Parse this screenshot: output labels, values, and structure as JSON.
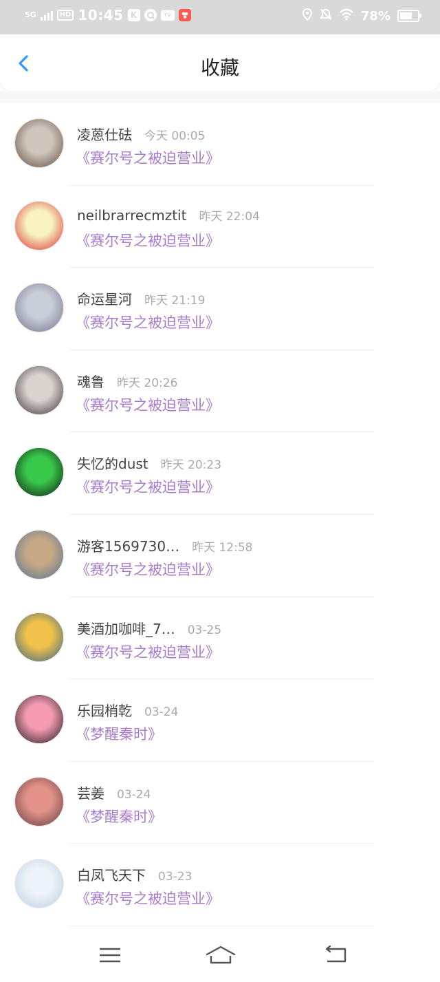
{
  "status_bar": {
    "network": "5G",
    "hd": "HD",
    "time": "10:45",
    "k_icon": "K",
    "tv_icon": "TV",
    "battery": "78%",
    "battery_level": 0.78
  },
  "header": {
    "title": "收藏",
    "back_icon": "chevron-left-icon"
  },
  "items": [
    {
      "name": "凌蒽仕砝",
      "time": "今天 00:05",
      "title": "《赛尔号之被迫营业》",
      "avatar_colors": [
        "#cfc7bd",
        "#5a4338"
      ]
    },
    {
      "name": "neilbrarrecmztit",
      "time": "昨天 22:04",
      "title": "《赛尔号之被迫营业》",
      "avatar_colors": [
        "#f7f2bf",
        "#d8232a"
      ]
    },
    {
      "name": "命运星河",
      "time": "昨天 21:19",
      "title": "《赛尔号之被迫营业》",
      "avatar_colors": [
        "#c9cdd8",
        "#6d6f86"
      ]
    },
    {
      "name": "魂鲁",
      "time": "昨天 20:26",
      "title": "《赛尔号之被迫营业》",
      "avatar_colors": [
        "#d8d3cf",
        "#2f2a28"
      ]
    },
    {
      "name": "失忆的dust",
      "time": "昨天 20:23",
      "title": "《赛尔号之被迫营业》",
      "avatar_colors": [
        "#39c94a",
        "#0c0d12"
      ]
    },
    {
      "name": "游客1569730…",
      "time": "昨天 12:58",
      "title": "《赛尔号之被迫营业》",
      "avatar_colors": [
        "#c6a884",
        "#4d6f96"
      ]
    },
    {
      "name": "美酒加咖啡_7…",
      "time": "03-25",
      "title": "《赛尔号之被迫营业》",
      "avatar_colors": [
        "#f0c24a",
        "#2a5d8a"
      ]
    },
    {
      "name": "乐园梢乾",
      "time": "03-24",
      "title": "《梦醒秦时》",
      "avatar_colors": [
        "#f49ab1",
        "#101210"
      ]
    },
    {
      "name": "芸姜",
      "time": "03-24",
      "title": "《梦醒秦时》",
      "avatar_colors": [
        "#e3928a",
        "#5a3a3a"
      ]
    },
    {
      "name": "白凤飞天下",
      "time": "03-23",
      "title": "《赛尔号之被迫营业》",
      "avatar_colors": [
        "#eef3f9",
        "#b8cbe0"
      ]
    }
  ],
  "nav_bar": {
    "menu_icon": "menu-icon",
    "home_icon": "home-icon",
    "back_icon": "back-icon"
  },
  "colors": {
    "accent": "#3399ff",
    "title_link": "#a77ccc",
    "status_bar": "#d9d9d9"
  }
}
